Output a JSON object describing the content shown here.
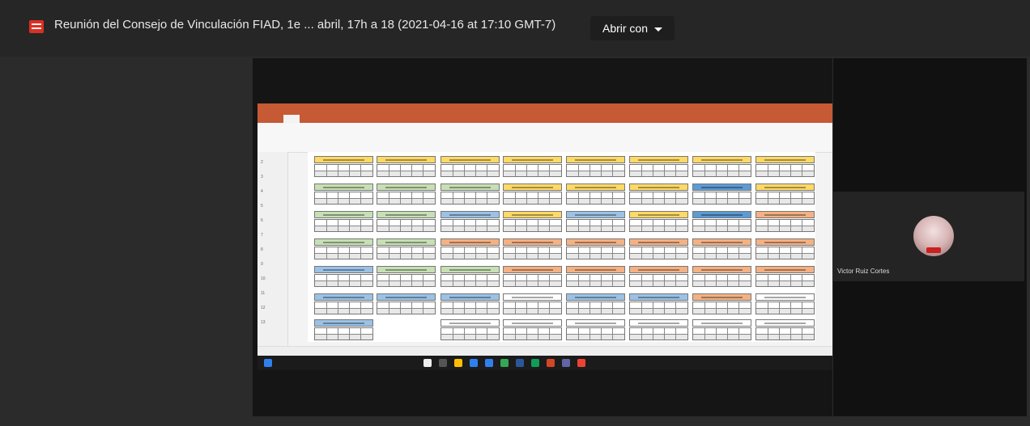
{
  "file": {
    "title": "Reunión del Consejo de Vinculación FIAD, 1e ... abril, 17h a 18 (2021-04-16 at 17:10 GMT-7)",
    "open_with": "Abrir con"
  },
  "participant": {
    "name": "Victor Ruiz Cortes"
  }
}
